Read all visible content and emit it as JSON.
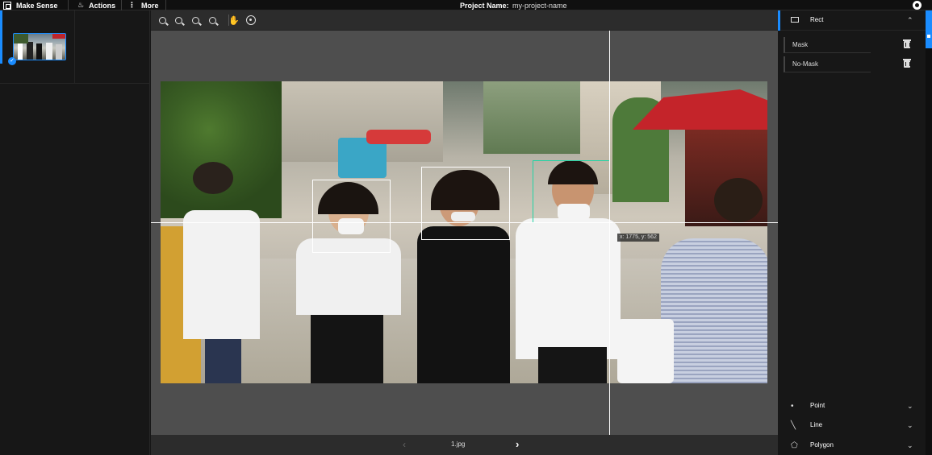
{
  "topbar": {
    "brand": "Make Sense",
    "actions": "Actions",
    "more": "More",
    "project_label": "Project Name:",
    "project_name": "my-project-name"
  },
  "images": [
    {
      "name": "thumbnail-1",
      "selected": true,
      "done": true
    },
    {
      "name": "thumbnail-2",
      "selected": false,
      "done": false
    }
  ],
  "toolbar": {
    "tools": [
      "zoom-in-icon",
      "zoom-out-icon",
      "zoom-fit-icon",
      "zoom-max-icon",
      "hand-icon",
      "crosshair-icon"
    ]
  },
  "canvas": {
    "cursor_readout": "x: 1775, y: 562",
    "filename": "1.jpg"
  },
  "right_panel": {
    "active_tool": "Rect",
    "labels": [
      {
        "text": "Mask"
      },
      {
        "text": "No-Mask"
      }
    ],
    "other_tools": [
      {
        "label": "Point",
        "icon": "point-icon"
      },
      {
        "label": "Line",
        "icon": "line-icon"
      },
      {
        "label": "Polygon",
        "icon": "polygon-icon"
      }
    ]
  },
  "colors": {
    "accent": "#1a8cff",
    "active_box": "#22d3a4",
    "box": "#ffffff"
  }
}
